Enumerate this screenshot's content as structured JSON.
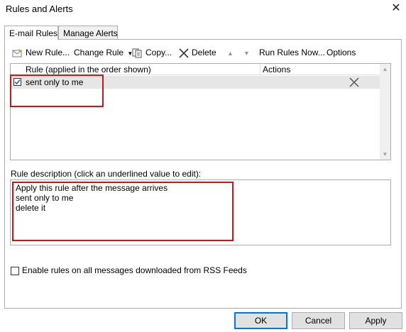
{
  "window": {
    "title": "Rules and Alerts",
    "close_glyph": "✕"
  },
  "tabs": [
    {
      "label": "E-mail Rules",
      "active": true
    },
    {
      "label": "Manage Alerts",
      "active": false
    }
  ],
  "toolbar": {
    "new_rule_label": "New Rule...",
    "change_rule_label": "Change Rule",
    "copy_label": "Copy...",
    "delete_label": "Delete",
    "run_rules_label": "Run Rules Now...",
    "options_label": "Options"
  },
  "rules_grid": {
    "columns": [
      "Rule (applied in the order shown)",
      "Actions"
    ],
    "rows": [
      {
        "name": "sent only to me",
        "enabled": true,
        "action_icon": "delete-x-icon"
      }
    ]
  },
  "description": {
    "label": "Rule description (click an underlined value to edit):",
    "lines": [
      "Apply this rule after the message arrives",
      "sent only to me",
      "delete it"
    ]
  },
  "rss_option": {
    "label": "Enable rules on all messages downloaded from RSS Feeds",
    "checked": false
  },
  "buttons": {
    "ok": "OK",
    "cancel": "Cancel",
    "apply": "Apply"
  },
  "colors": {
    "highlight_box": "#c8161d",
    "selected_row": "#e6e6e6",
    "default_button_border": "#0078d7"
  }
}
